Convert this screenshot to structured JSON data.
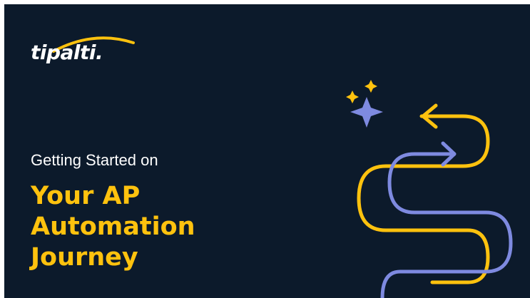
{
  "brand": {
    "logo_text": "tipalti.",
    "logo_color": "#ffffff",
    "arc_color": "#ffc20e"
  },
  "hero": {
    "subtitle": "Getting Started on",
    "headline_lines": [
      "Your AP",
      "Automation",
      "Journey"
    ]
  },
  "colors": {
    "background": "#0c1a2b",
    "accent_yellow": "#ffc20e",
    "accent_lavender": "#7e8ae0",
    "text": "#ffffff"
  },
  "icons": {
    "sparkles": "sparkle-stars-icon",
    "path": "winding-path-arrows-icon"
  }
}
